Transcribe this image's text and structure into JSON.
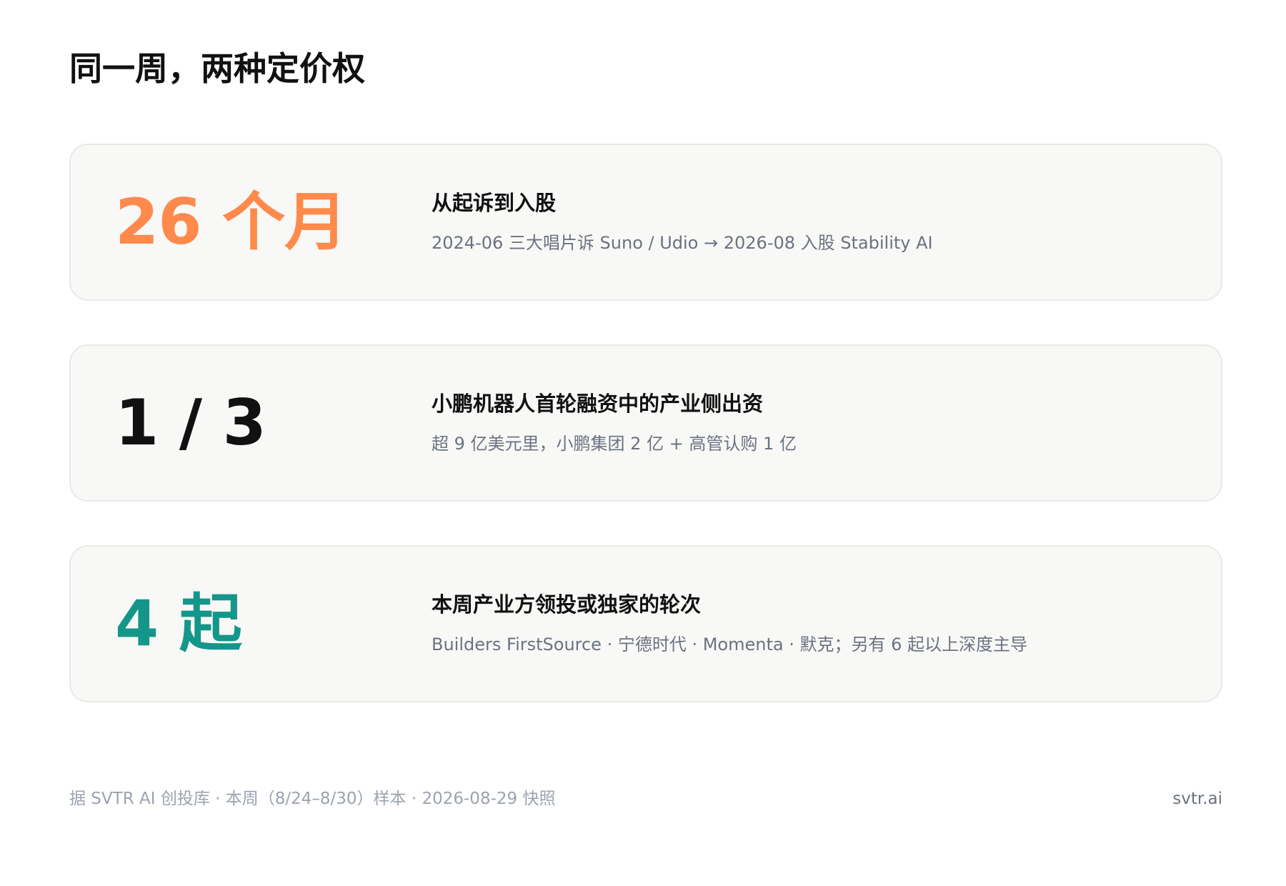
{
  "title": "同一周，两种定价权",
  "colors": {
    "accent_orange": "#ff8a4c",
    "accent_teal": "#14968a",
    "stat_dark": "#111111"
  },
  "cards": [
    {
      "stat": "26 个月",
      "stat_color": "#ff8a4c",
      "heading": "从起诉到入股",
      "description": "2024-06 三大唱片诉 Suno / Udio → 2026-08 入股 Stability AI"
    },
    {
      "stat": "1 / 3",
      "stat_color": "#111111",
      "heading": "小鹏机器人首轮融资中的产业侧出资",
      "description": "超 9 亿美元里，小鹏集团 2 亿 + 高管认购 1 亿"
    },
    {
      "stat": "4 起",
      "stat_color": "#14968a",
      "heading": "本周产业方领投或独家的轮次",
      "description": "Builders FirstSource · 宁德时代 · Momenta · 默克；另有 6 起以上深度主导"
    }
  ],
  "footer": {
    "source": "据 SVTR AI 创投库 · 本周（8/24–8/30）样本 · 2026-08-29 快照",
    "site": "svtr.ai"
  }
}
